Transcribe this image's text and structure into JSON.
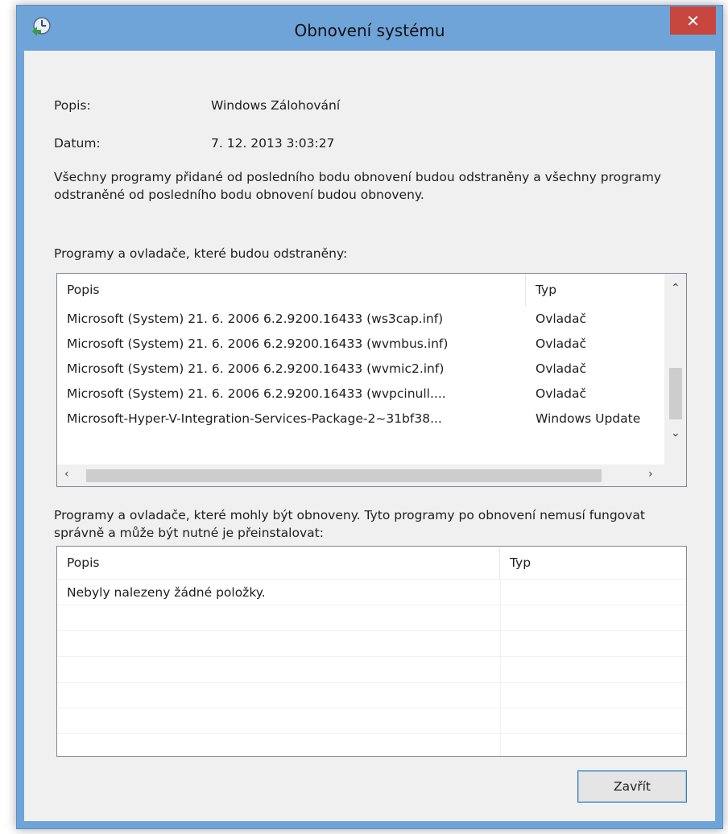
{
  "window": {
    "title": "Obnovení systému",
    "close_label": "✕",
    "icon": "system-restore-icon"
  },
  "info": {
    "description_label": "Popis:",
    "description_value": "Windows Zálohování",
    "date_label": "Datum:",
    "date_value": "7. 12. 2013 3:03:27"
  },
  "intro_text": "Všechny programy přidané od posledního bodu obnovení budou odstraněny a všechny programy odstraněné od posledního bodu obnovení budou obnoveny.",
  "removed": {
    "heading": "Programy a ovladače, které budou odstraněny:",
    "columns": [
      "Popis",
      "Typ"
    ],
    "rows": [
      {
        "popis": "Microsoft (System) 21. 6. 2006 6.2.9200.16433 (ws3cap.inf)",
        "typ": "Ovladač"
      },
      {
        "popis": "Microsoft (System) 21. 6. 2006 6.2.9200.16433 (wvmbus.inf)",
        "typ": "Ovladač"
      },
      {
        "popis": "Microsoft (System) 21. 6. 2006 6.2.9200.16433 (wvmic2.inf)",
        "typ": "Ovladač"
      },
      {
        "popis": "Microsoft (System) 21. 6. 2006 6.2.9200.16433 (wvpcinull....",
        "typ": "Ovladač"
      },
      {
        "popis": "Microsoft-Hyper-V-Integration-Services-Package-2~31bf38...",
        "typ": "Windows Update"
      }
    ]
  },
  "restored": {
    "heading": "Programy a ovladače, které mohly být obnoveny. Tyto programy po obnovení nemusí fungovat správně a může být nutné je přeinstalovat:",
    "columns": [
      "Popis",
      "Typ"
    ],
    "empty_text": "Nebyly nalezeny žádné položky."
  },
  "buttons": {
    "close": "Zavřít"
  },
  "colors": {
    "title_bar": "#6fa4d9",
    "close_button": "#c7463d",
    "client": "#f0f0f0"
  }
}
